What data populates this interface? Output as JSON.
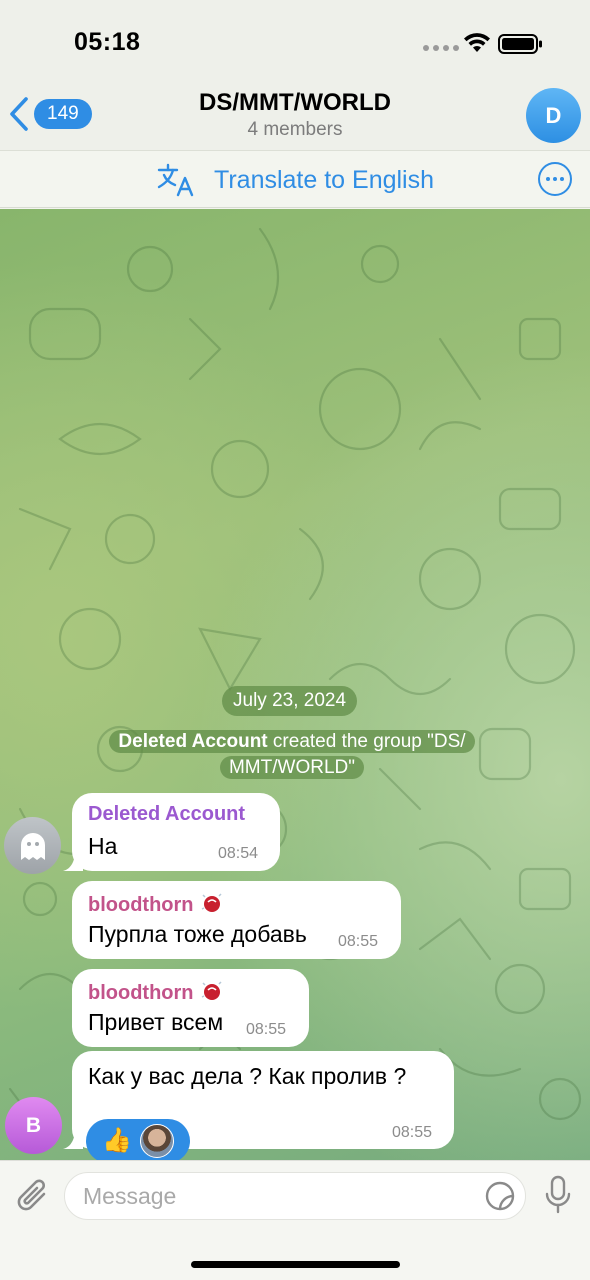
{
  "status_bar": {
    "time": "05:18"
  },
  "header": {
    "back_count": "149",
    "title": "DS/MMT/WORLD",
    "subtitle": "4 members",
    "avatar_letter": "D"
  },
  "translate_bar": {
    "label": "Translate to English"
  },
  "chat": {
    "date": "July 23, 2024",
    "service_message": {
      "actor": "Deleted Account",
      "line1_rest": " created the group \"DS/",
      "line2": "MMT/WORLD\""
    },
    "messages": [
      {
        "sender": "Deleted Account",
        "text": "На",
        "time": "08:54",
        "sender_color": "#9b59d0"
      },
      {
        "sender": "bloodthorn",
        "text": "Пурпла тоже добавь",
        "time": "08:55",
        "sender_color": "#c2538a"
      },
      {
        "sender": "bloodthorn",
        "text": "Привет всем",
        "time": "08:55",
        "sender_color": "#c2538a"
      },
      {
        "text": "Как у вас дела ? Как пролив ?",
        "time": "08:55",
        "reaction": "👍"
      }
    ],
    "sender_avatar_letter": "B"
  },
  "input_bar": {
    "placeholder": "Message"
  },
  "colors": {
    "accent": "#2f8de4",
    "chat_bg": "#8dbb7d",
    "bubble": "#ffffff"
  }
}
